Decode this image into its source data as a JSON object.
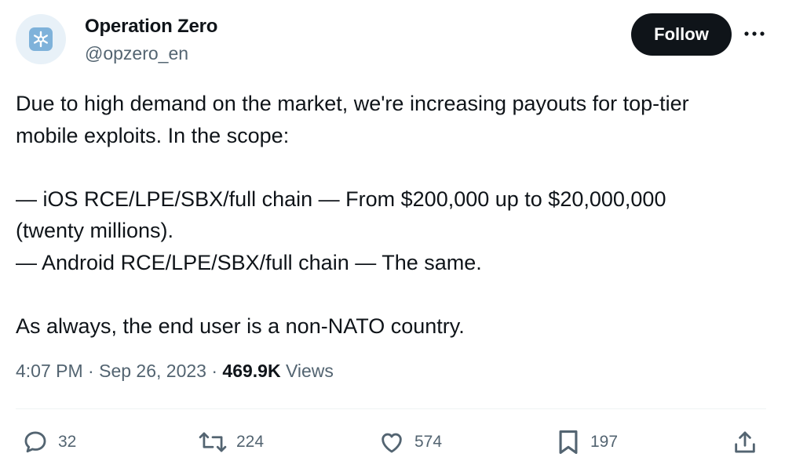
{
  "author": {
    "name": "Operation Zero",
    "handle": "@opzero_en",
    "avatar_icon": "snowflake-logo-icon"
  },
  "follow_label": "Follow",
  "more_icon": "more-horizontal-icon",
  "tweet": {
    "lines": [
      "Due to high demand on the market, we're increasing payouts for top-tier",
      "mobile exploits. In the scope:",
      "",
      "— iOS RCE/LPE/SBX/full chain — From $200,000 up to $20,000,000",
      "(twenty millions).",
      "— Android RCE/LPE/SBX/full chain — The same.",
      "",
      "As always, the end user is a non-NATO country."
    ]
  },
  "meta": {
    "time": "4:07 PM",
    "sep1": "·",
    "date": "Sep 26, 2023",
    "sep2": "·",
    "views_count": "469.9K",
    "views_label": "Views"
  },
  "actions": {
    "replies": "32",
    "reposts": "224",
    "likes": "574",
    "bookmarks": "197"
  },
  "colors": {
    "text": "#0f1419",
    "secondary": "#536471",
    "follow_bg": "#0f1419",
    "avatar_bg": "#e8f1f8",
    "avatar_tile": "#7fb2da"
  }
}
